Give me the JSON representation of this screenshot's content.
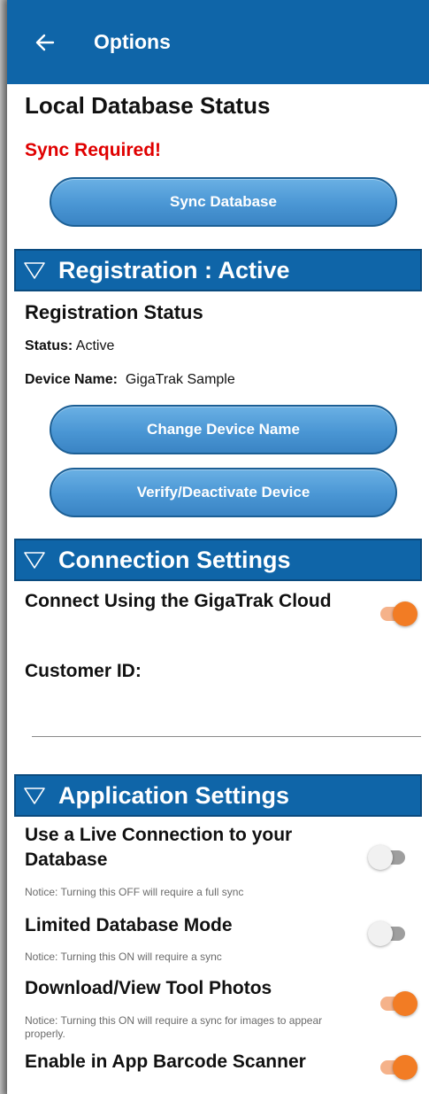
{
  "appbar": {
    "title": "Options",
    "back_icon": "arrow-left-icon"
  },
  "local_db": {
    "title": "Local Database Status",
    "warning": "Sync Required!",
    "sync_button": "Sync Database"
  },
  "registration": {
    "section_title": "Registration : Active",
    "subtitle": "Registration Status",
    "status_label": "Status:",
    "status_value": "Active",
    "device_label": "Device Name:",
    "device_value": "GigaTrak Sample",
    "change_button": "Change Device Name",
    "verify_button": "Verify/Deactivate Device"
  },
  "connection": {
    "section_title": "Connection Settings",
    "cloud_label": "Connect Using the GigaTrak Cloud",
    "cloud_on": true,
    "customer_label": "Customer ID:",
    "customer_value": ""
  },
  "application": {
    "section_title": "Application Settings",
    "live_label": "Use a Live Connection to your Database",
    "live_notice": "Notice: Turning this OFF will require a full sync",
    "live_on": false,
    "limited_label": "Limited Database Mode",
    "limited_notice": "Notice: Turning this ON will require a sync",
    "limited_on": false,
    "photos_label": "Download/View Tool Photos",
    "photos_notice": "Notice: Turning this ON will require a sync for images to appear properly.",
    "photos_on": true,
    "scanner_label": "Enable in App Barcode Scanner",
    "scanner_on": true
  },
  "colors": {
    "primary": "#0f65a8",
    "accent": "#f27c24",
    "warning": "#e00000"
  }
}
